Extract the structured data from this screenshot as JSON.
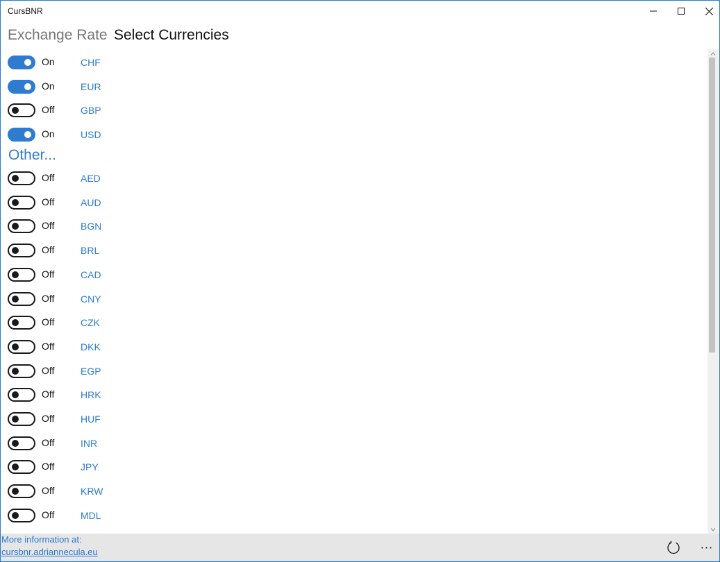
{
  "window": {
    "title": "CursBNR"
  },
  "header": {
    "tab_inactive": "Exchange Rate",
    "tab_active": "Select Currencies"
  },
  "main_currencies": [
    {
      "state": "On",
      "code": "CHF",
      "checked": true
    },
    {
      "state": "On",
      "code": "EUR",
      "checked": true
    },
    {
      "state": "Off",
      "code": "GBP",
      "checked": false
    },
    {
      "state": "On",
      "code": "USD",
      "checked": true
    }
  ],
  "other_section": {
    "title": "Other..."
  },
  "other_currencies": [
    {
      "state": "Off",
      "code": "AED",
      "checked": false
    },
    {
      "state": "Off",
      "code": "AUD",
      "checked": false
    },
    {
      "state": "Off",
      "code": "BGN",
      "checked": false
    },
    {
      "state": "Off",
      "code": "BRL",
      "checked": false
    },
    {
      "state": "Off",
      "code": "CAD",
      "checked": false
    },
    {
      "state": "Off",
      "code": "CNY",
      "checked": false
    },
    {
      "state": "Off",
      "code": "CZK",
      "checked": false
    },
    {
      "state": "Off",
      "code": "DKK",
      "checked": false
    },
    {
      "state": "Off",
      "code": "EGP",
      "checked": false
    },
    {
      "state": "Off",
      "code": "HRK",
      "checked": false
    },
    {
      "state": "Off",
      "code": "HUF",
      "checked": false
    },
    {
      "state": "Off",
      "code": "INR",
      "checked": false
    },
    {
      "state": "Off",
      "code": "JPY",
      "checked": false
    },
    {
      "state": "Off",
      "code": "KRW",
      "checked": false
    },
    {
      "state": "Off",
      "code": "MDL",
      "checked": false
    }
  ],
  "footer": {
    "more_info": "More information  at:",
    "link": "cursbnr.adriannecula.eu",
    "more_label": "···"
  },
  "icons": {
    "minimize": "minimize-icon",
    "maximize": "maximize-icon",
    "close": "close-icon",
    "refresh": "refresh-icon",
    "more": "more-icon"
  },
  "colors": {
    "accent": "#2f7bd0",
    "bottom_bar": "#e6e6e6"
  }
}
